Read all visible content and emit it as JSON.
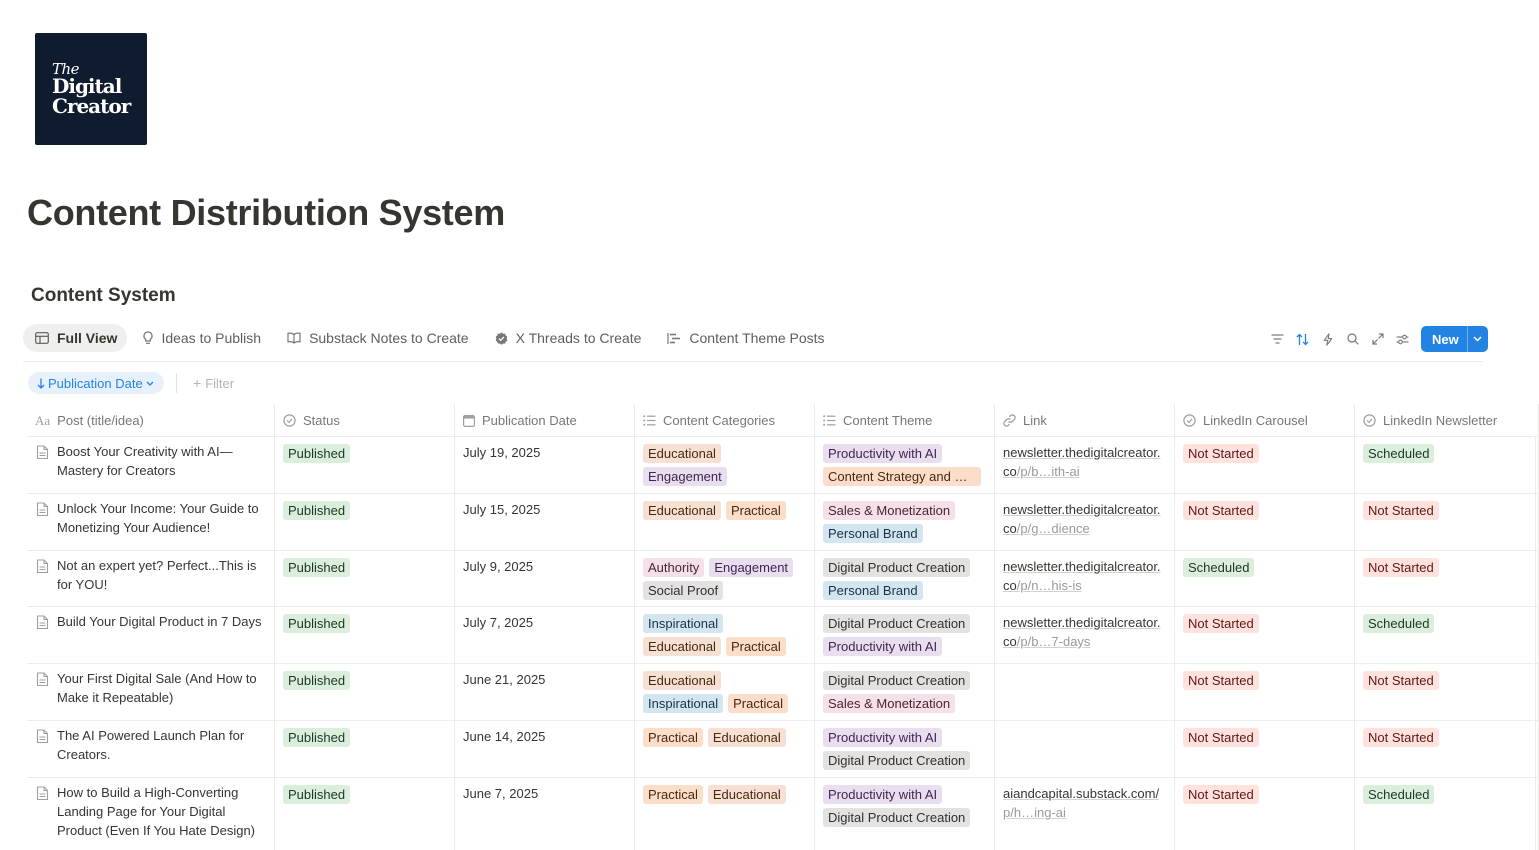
{
  "logo": {
    "line1": "The",
    "line2": "Digital",
    "line3": "Creator"
  },
  "page": {
    "title": "Content Distribution System"
  },
  "database": {
    "title": "Content System"
  },
  "tabs": [
    {
      "label": "Full View",
      "icon": "table-icon"
    },
    {
      "label": "Ideas to Publish",
      "icon": "lightbulb-icon"
    },
    {
      "label": "Substack Notes to Create",
      "icon": "book-icon"
    },
    {
      "label": "X Threads to Create",
      "icon": "verified-badge-icon"
    },
    {
      "label": "Content Theme Posts",
      "icon": "timeline-icon"
    }
  ],
  "toolbar": {
    "new_label": "New"
  },
  "sort": {
    "label": "Publication Date"
  },
  "filter": {
    "label": "Filter"
  },
  "columns": [
    {
      "label": "Post (title/idea)",
      "icon": "text-icon",
      "icon_text": "Aa"
    },
    {
      "label": "Status",
      "icon": "status-icon"
    },
    {
      "label": "Publication Date",
      "icon": "calendar-icon"
    },
    {
      "label": "Content Categories",
      "icon": "list-icon"
    },
    {
      "label": "Content Theme",
      "icon": "list-icon"
    },
    {
      "label": "Link",
      "icon": "link-icon"
    },
    {
      "label": "LinkedIn Carousel",
      "icon": "status-icon"
    },
    {
      "label": "LinkedIn Newsletter",
      "icon": "status-icon"
    }
  ],
  "tag_colors": {
    "Published": [
      "#dbeddb",
      "#1c3829"
    ],
    "Scheduled": [
      "#dbeddb",
      "#1c3829"
    ],
    "Not Started": [
      "#ffe2dd",
      "#5d1715"
    ],
    "Educational": [
      "#f5e0d3",
      "#49290e"
    ],
    "Practical": [
      "#fadec9",
      "#49290e"
    ],
    "Engagement": [
      "#e8deee",
      "#412454"
    ],
    "Authority": [
      "#f5e0e9",
      "#4c2337"
    ],
    "Social Proof": [
      "#e3e2e0",
      "#32302c"
    ],
    "Inspirational": [
      "#d3e5ef",
      "#183347"
    ],
    "Productivity with AI": [
      "#e8deee",
      "#412454"
    ],
    "Content Strategy and Systems": [
      "#fadec9",
      "#49290e"
    ],
    "Sales & Monetization": [
      "#f5e0e9",
      "#4c2337"
    ],
    "Personal Brand": [
      "#d3e5ef",
      "#183347"
    ],
    "Digital Product Creation": [
      "#e3e2e0",
      "#32302c"
    ]
  },
  "rows": [
    {
      "title": "Boost Your Creativity with AI—Mastery for Creators",
      "status": "Published",
      "date": "July 19, 2025",
      "categories": [
        "Educational",
        "Engagement"
      ],
      "themes": [
        "Productivity with AI",
        "Content Strategy and Systems"
      ],
      "link_main": "newsletter.thedigitalcreator.co",
      "link_tail": "/p/b…ith-ai",
      "carousel": "Not Started",
      "newsletter": "Scheduled",
      "height": 57
    },
    {
      "title": "Unlock Your Income: Your Guide to Monetizing Your Audience!",
      "status": "Published",
      "date": "July 15, 2025",
      "categories": [
        "Educational",
        "Practical"
      ],
      "themes": [
        "Sales & Monetization",
        "Personal Brand"
      ],
      "link_main": "newsletter.thedigitalcreator.co",
      "link_tail": "/p/g…dience",
      "carousel": "Not Started",
      "newsletter": "Not Started",
      "height": 57
    },
    {
      "title": "Not an expert yet? Perfect...This is for YOU!",
      "status": "Published",
      "date": "July 9, 2025",
      "categories": [
        "Authority",
        "Engagement",
        "Social Proof"
      ],
      "themes": [
        "Digital Product Creation",
        "Personal Brand"
      ],
      "link_main": "newsletter.thedigitalcreator.co",
      "link_tail": "/p/n…his-is",
      "carousel": "Scheduled",
      "newsletter": "Not Started",
      "height": 56
    },
    {
      "title": "Build Your Digital Product in 7 Days",
      "status": "Published",
      "date": "July 7, 2025",
      "categories": [
        "Inspirational",
        "Educational",
        "Practical"
      ],
      "themes": [
        "Digital Product Creation",
        "Productivity with AI"
      ],
      "link_main": "newsletter.thedigitalcreator.co",
      "link_tail": "/p/b…7-days",
      "carousel": "Not Started",
      "newsletter": "Scheduled",
      "height": 57
    },
    {
      "title": "Your First Digital Sale (And How to Make it Repeatable)",
      "status": "Published",
      "date": "June 21, 2025",
      "categories": [
        "Educational",
        "Inspirational",
        "Practical"
      ],
      "themes": [
        "Digital Product Creation",
        "Sales & Monetization"
      ],
      "link_main": "",
      "link_tail": "",
      "carousel": "Not Started",
      "newsletter": "Not Started",
      "height": 57
    },
    {
      "title": "The AI Powered Launch Plan for Creators.",
      "status": "Published",
      "date": "June 14, 2025",
      "categories": [
        "Practical",
        "Educational"
      ],
      "themes": [
        "Productivity with AI",
        "Digital Product Creation"
      ],
      "link_main": "",
      "link_tail": "",
      "carousel": "Not Started",
      "newsletter": "Not Started",
      "height": 57
    },
    {
      "title": "How to Build a High-Converting Landing Page for Your Digital Product (Even If You Hate Design)",
      "status": "Published",
      "date": "June 7, 2025",
      "categories": [
        "Practical",
        "Educational"
      ],
      "themes": [
        "Productivity with AI",
        "Digital Product Creation"
      ],
      "link_main": "aiandcapital.substack.com/",
      "link_tail": "p/h…ing-ai",
      "carousel": "Not Started",
      "newsletter": "Scheduled",
      "height": 74
    }
  ]
}
